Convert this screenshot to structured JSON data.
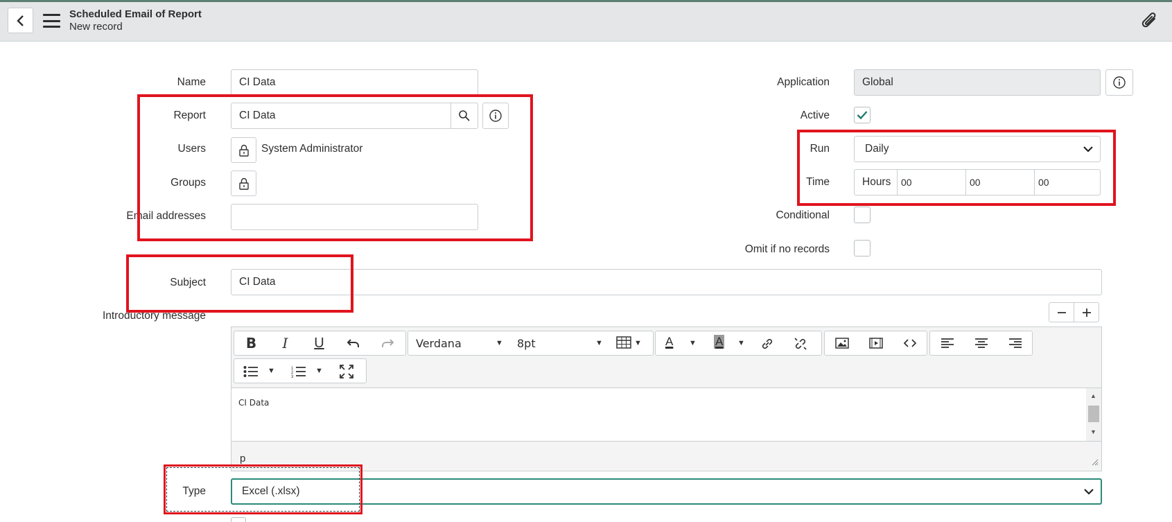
{
  "header": {
    "title": "Scheduled Email of Report",
    "subtitle": "New record"
  },
  "form": {
    "name": {
      "label": "Name",
      "value": "CI Data"
    },
    "report": {
      "label": "Report",
      "value": "CI Data"
    },
    "users": {
      "label": "Users",
      "value": "System Administrator"
    },
    "groups": {
      "label": "Groups"
    },
    "email": {
      "label": "Email addresses",
      "value": ""
    },
    "subject": {
      "label": "Subject",
      "value": "CI Data"
    },
    "intro": {
      "label": "Introductory message"
    },
    "type": {
      "label": "Type",
      "value": "Excel (.xlsx)"
    },
    "application": {
      "label": "Application",
      "value": "Global"
    },
    "active": {
      "label": "Active",
      "checked": true
    },
    "run": {
      "label": "Run",
      "value": "Daily"
    },
    "time": {
      "label": "Time",
      "unit": "Hours",
      "h": "00",
      "m": "00",
      "s": "00"
    },
    "conditional": {
      "label": "Conditional",
      "checked": false
    },
    "omit": {
      "label": "Omit if no records",
      "checked": false
    }
  },
  "editor": {
    "font": "Verdana",
    "size": "8pt",
    "content": "CI Data",
    "path": "p"
  },
  "colors": {
    "highlight": "#e0141e",
    "accent": "#5e7f74"
  }
}
